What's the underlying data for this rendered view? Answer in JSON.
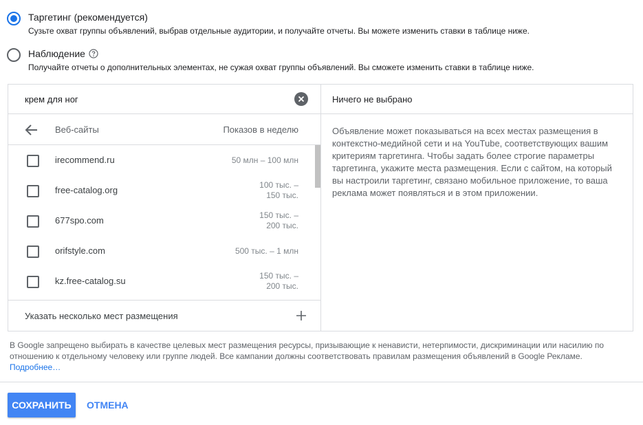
{
  "targeting": {
    "option1": {
      "title": "Таргетинг (рекомендуется)",
      "desc": "Сузьте охват группы объявлений, выбрав отдельные аудитории, и получайте отчеты. Вы можете изменить ставки в таблице ниже.",
      "selected": true
    },
    "option2": {
      "title": "Наблюдение",
      "desc": "Получайте отчеты о дополнительных элементах, не сужая охват группы объявлений. Вы сможете изменить ставки в таблице ниже.",
      "selected": false
    }
  },
  "search": {
    "value": "крем для ног"
  },
  "list": {
    "header_label": "Веб-сайты",
    "header_right": "Показов в неделю",
    "items": [
      {
        "site": "irecommend.ru",
        "impr1": "50 млн – 100 млн",
        "impr2": ""
      },
      {
        "site": "free-catalog.org",
        "impr1": "100 тыс. –",
        "impr2": "150 тыс."
      },
      {
        "site": "677spo.com",
        "impr1": "150 тыс. –",
        "impr2": "200 тыс."
      },
      {
        "site": "orifstyle.com",
        "impr1": "500 тыс. – 1 млн",
        "impr2": ""
      },
      {
        "site": "kz.free-catalog.su",
        "impr1": "150 тыс. –",
        "impr2": "200 тыс."
      }
    ],
    "add_label": "Указать несколько мест размещения"
  },
  "right_pane": {
    "title": "Ничего не выбрано",
    "body": "Объявление может показываться на всех местах размещения в контекстно-медийной сети и на YouTube, соответствующих вашим критериям таргетинга. Чтобы задать более строгие параметры таргетинга, укажите места размещения. Если с сайтом, на который вы настроили таргетинг, связано мобильное приложение, то ваша реклама может появляться и в этом приложении."
  },
  "policy": {
    "text": "В Google запрещено выбирать в качестве целевых мест размещения ресурсы, призывающие к ненависти, нетерпимости, дискриминации или насилию по отношению к отдельному человеку или группе людей. Все кампании должны соответствовать правилам размещения объявлений в Google Рекламе. ",
    "link": "Подробнее…"
  },
  "actions": {
    "save": "СОХРАНИТЬ",
    "cancel": "ОТМЕНА"
  },
  "colors": {
    "accent": "#1a73e8",
    "button": "#4285f4"
  },
  "icons": [
    "radio-checked-icon",
    "radio-unchecked-icon",
    "help-circle-icon",
    "clear-icon",
    "back-arrow-icon",
    "checkbox-icon",
    "plus-icon"
  ]
}
